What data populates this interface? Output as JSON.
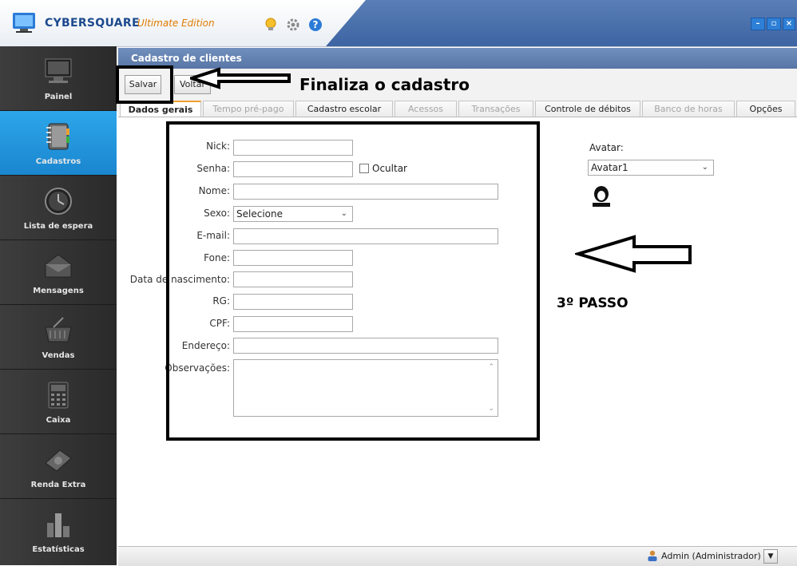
{
  "app": {
    "brand": "CYBERSQUARE",
    "edition": "Ultimate Edition"
  },
  "window_buttons": [
    "–",
    "▫",
    "×"
  ],
  "sidebar": {
    "items": [
      {
        "label": "Painel",
        "icon": "monitor-icon",
        "active": false
      },
      {
        "label": "Cadastros",
        "icon": "notebook-icon",
        "active": true
      },
      {
        "label": "Lista de espera",
        "icon": "clock-icon",
        "active": false
      },
      {
        "label": "Mensagens",
        "icon": "envelope-icon",
        "active": false
      },
      {
        "label": "Vendas",
        "icon": "basket-icon",
        "active": false
      },
      {
        "label": "Caixa",
        "icon": "calculator-icon",
        "active": false
      },
      {
        "label": "Renda Extra",
        "icon": "money-icon",
        "active": false
      },
      {
        "label": "Estatísticas",
        "icon": "bar-chart-icon",
        "active": false
      }
    ]
  },
  "panel": {
    "title": "Cadastro de clientes"
  },
  "toolbar": {
    "save_label": "Salvar",
    "back_label": "Voltar"
  },
  "tabs": [
    {
      "label": "Dados gerais",
      "state": "active"
    },
    {
      "label": "Tempo pré-pago",
      "state": "disabled"
    },
    {
      "label": "Cadastro escolar",
      "state": "normal"
    },
    {
      "label": "Acessos",
      "state": "disabled"
    },
    {
      "label": "Transações",
      "state": "disabled"
    },
    {
      "label": "Controle de débitos",
      "state": "normal"
    },
    {
      "label": "Banco de horas",
      "state": "disabled"
    },
    {
      "label": "Opções",
      "state": "normal"
    }
  ],
  "form": {
    "nick_label": "Nick:",
    "senha_label": "Senha:",
    "ocultar_label": "Ocultar",
    "nome_label": "Nome:",
    "sexo_label": "Sexo:",
    "sexo_value": "Selecione",
    "email_label": "E-mail:",
    "fone_label": "Fone:",
    "nascimento_label": "Data de nascimento:",
    "rg_label": "RG:",
    "cpf_label": "CPF:",
    "endereco_label": "Endereço:",
    "observacoes_label": "Observações:"
  },
  "avatar": {
    "label": "Avatar:",
    "value": "Avatar1"
  },
  "annotations": {
    "finaliza": "Finaliza o cadastro",
    "passo": "3º PASSO"
  },
  "status": {
    "user": "Admin (Administrador)"
  }
}
